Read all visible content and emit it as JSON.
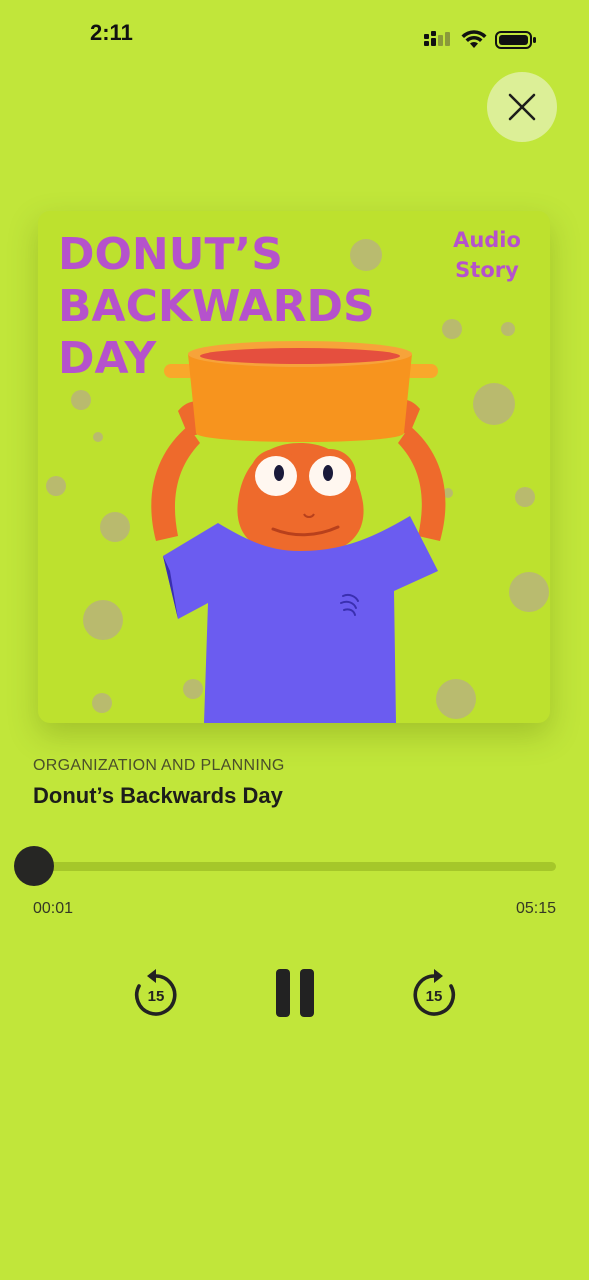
{
  "status_bar": {
    "time": "2:11",
    "icons": [
      "signal-icon",
      "wifi-icon",
      "battery-icon"
    ]
  },
  "header": {
    "close_icon": "close-icon"
  },
  "cover": {
    "title": "DONUT’S BACKWARDS DAY",
    "tag": "Audio Story"
  },
  "track": {
    "category": "ORGANIZATION AND PLANNING",
    "title": "Donut’s Backwards Day"
  },
  "playback": {
    "elapsed": "00:01",
    "total": "05:15",
    "progress_fraction": 0.003
  },
  "controls": {
    "rewind_seconds": "15",
    "forward_seconds": "15",
    "state_icon": "pause-icon"
  },
  "colors": {
    "background": "#c1e63a",
    "cover_title": "#b552cc",
    "knob": "#262624"
  }
}
